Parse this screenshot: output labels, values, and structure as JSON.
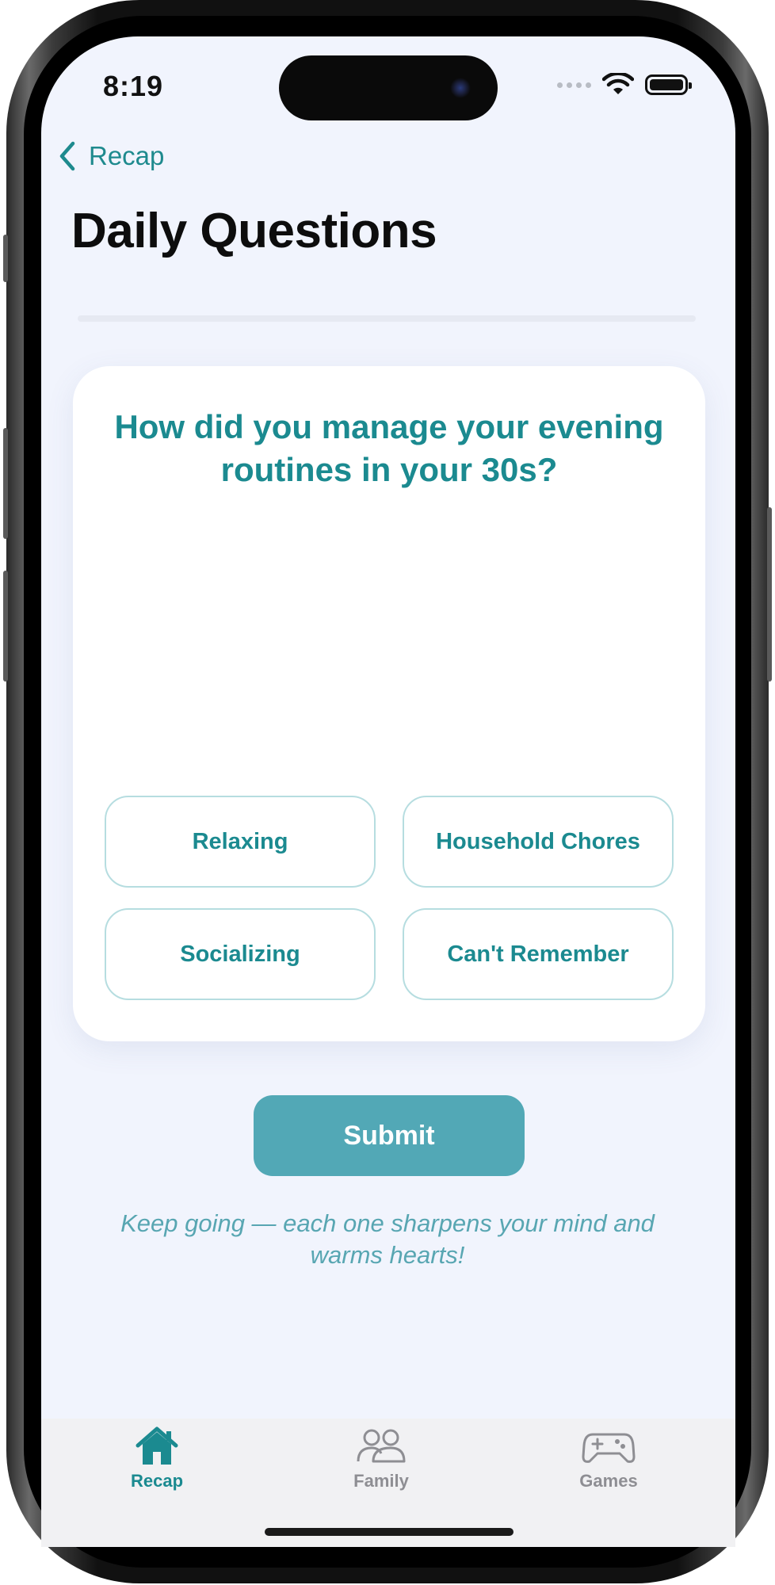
{
  "status_bar": {
    "time": "8:19"
  },
  "nav": {
    "back_label": "Recap",
    "title": "Daily Questions"
  },
  "question_card": {
    "question": "How did you manage your evening routines in your 30s?",
    "options": [
      "Relaxing",
      "Household Chores",
      "Socializing",
      "Can't Remember"
    ]
  },
  "submit_label": "Submit",
  "encouragement": "Keep going — each one sharpens your mind and warms hearts!",
  "tab_bar": {
    "tabs": [
      {
        "label": "Recap",
        "icon": "home-icon",
        "active": true
      },
      {
        "label": "Family",
        "icon": "people-icon",
        "active": false
      },
      {
        "label": "Games",
        "icon": "gamepad-icon",
        "active": false
      }
    ]
  },
  "colors": {
    "accent": "#1b8a90",
    "submit": "#52a8b6",
    "background": "#f1f4fd",
    "inactive_tab": "#8e8e93"
  }
}
